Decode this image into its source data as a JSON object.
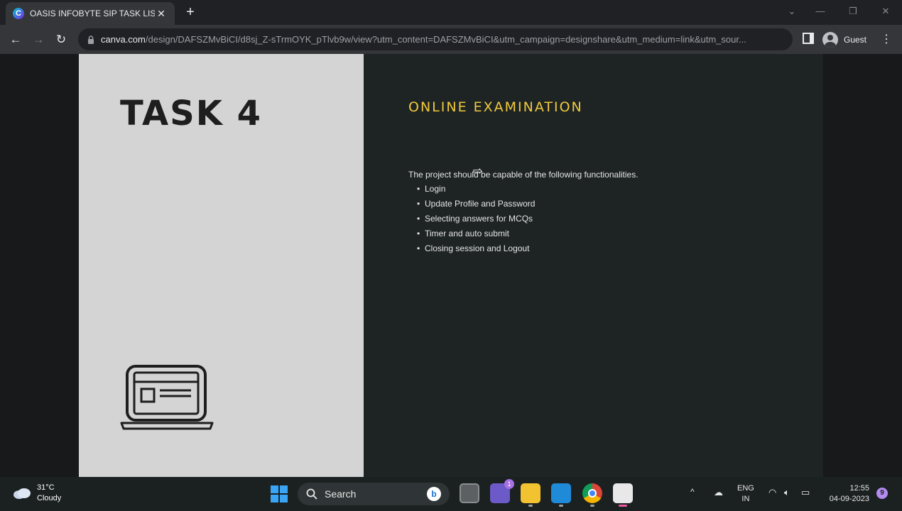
{
  "browser": {
    "tab_title": "OASIS INFOBYTE SIP TASK LIST",
    "tab_favicon_letter": "C",
    "url_host": "canva.com",
    "url_path": "/design/DAFSZMvBiCI/d8sj_Z-sTrmOYK_pTlvb9w/view?utm_content=DAFSZMvBiCI&utm_campaign=designshare&utm_medium=link&utm_sour...",
    "profile_label": "Guest"
  },
  "slide": {
    "task_title": "TASK 4",
    "heading": "ONLINE EXAMINATION",
    "description": "The project should be capable of the following functionalities.",
    "features": [
      "Login",
      "Update Profile and Password",
      "Selecting answers for MCQs",
      "Timer and auto submit",
      "Closing session and Logout"
    ],
    "heading_color": "#f0c93d"
  },
  "taskbar": {
    "temperature": "31°C",
    "condition": "Cloudy",
    "search_label": "Search",
    "teams_badge": "1",
    "lang_line1": "ENG",
    "lang_line2": "IN",
    "time": "12:55",
    "date": "04-09-2023",
    "notification_count": "9"
  },
  "icons": [
    "canva-icon",
    "close-icon",
    "plus-icon",
    "back-arrow-icon",
    "forward-arrow-icon",
    "reload-icon",
    "lock-icon",
    "side-panel-icon",
    "profile-icon",
    "more-vert-icon",
    "laptop-icon",
    "cloud-icon",
    "windows-start-icon",
    "search-icon",
    "bing-icon",
    "task-view-icon",
    "teams-icon",
    "file-explorer-icon",
    "vscode-icon",
    "chrome-icon",
    "snipping-tool-icon",
    "chevron-up-icon",
    "onedrive-icon",
    "wifi-icon",
    "speaker-icon",
    "battery-icon"
  ]
}
